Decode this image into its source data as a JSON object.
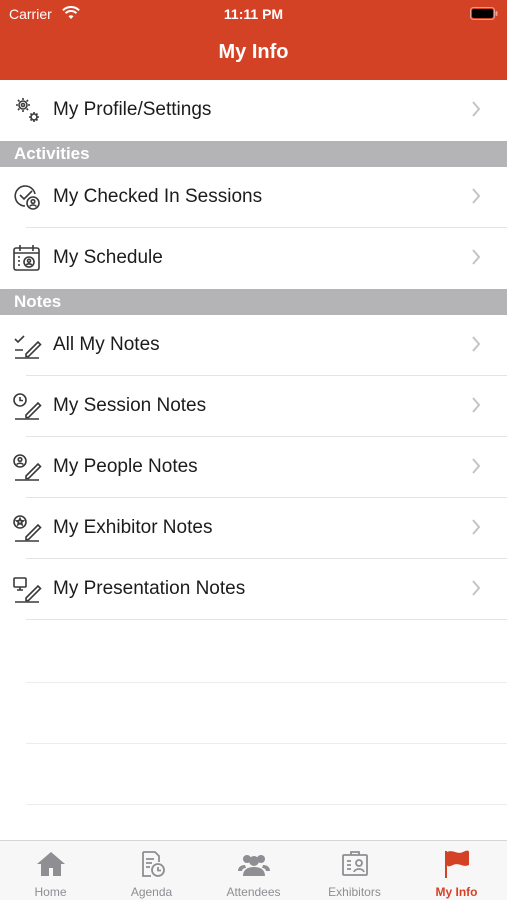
{
  "status_bar": {
    "carrier": "Carrier",
    "time": "11:11 PM"
  },
  "nav": {
    "title": "My Info"
  },
  "profile_row": {
    "label": "My Profile/Settings",
    "icon": "gears-icon"
  },
  "sections": {
    "activities": {
      "title": "Activities",
      "items": [
        {
          "label": "My Checked In Sessions",
          "icon": "checked-in-icon"
        },
        {
          "label": "My Schedule",
          "icon": "calendar-person-icon"
        }
      ]
    },
    "notes": {
      "title": "Notes",
      "items": [
        {
          "label": "All My Notes",
          "icon": "note-check-icon"
        },
        {
          "label": "My Session Notes",
          "icon": "note-clock-icon"
        },
        {
          "label": "My People Notes",
          "icon": "note-person-icon"
        },
        {
          "label": "My Exhibitor Notes",
          "icon": "note-star-icon"
        },
        {
          "label": "My Presentation Notes",
          "icon": "note-presentation-icon"
        }
      ]
    }
  },
  "tab_bar": {
    "tabs": [
      {
        "label": "Home",
        "icon": "home-icon",
        "active": false
      },
      {
        "label": "Agenda",
        "icon": "agenda-icon",
        "active": false
      },
      {
        "label": "Attendees",
        "icon": "attendees-icon",
        "active": false
      },
      {
        "label": "Exhibitors",
        "icon": "exhibitors-icon",
        "active": false
      },
      {
        "label": "My Info",
        "icon": "flag-icon",
        "active": true
      }
    ]
  },
  "colors": {
    "accent": "#d44226",
    "section_bg": "#b4b4b6",
    "tab_inactive": "#8e8e93"
  }
}
